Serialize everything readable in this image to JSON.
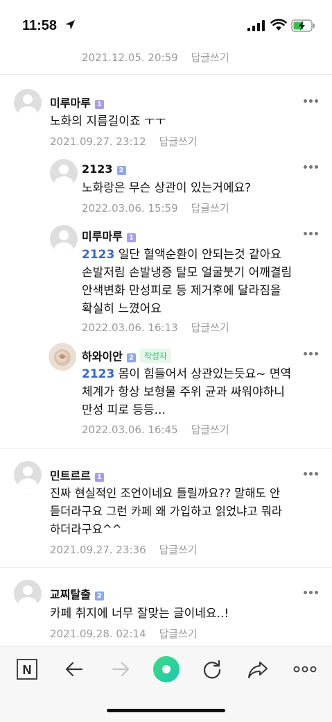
{
  "status_bar": {
    "time": "11:58"
  },
  "top_meta": {
    "date": "2021.12.05. 20:59",
    "reply": "답글쓰기"
  },
  "comments": [
    {
      "nick": "미루마루",
      "level": "1",
      "text": "노화의 지름길이죠 ㅜㅜ",
      "date": "2021.09.27. 23:12",
      "reply": "답글쓰기"
    },
    {
      "nick": "2123",
      "level": "2",
      "text": "노화랑은 무슨 상관이 있는거에요?",
      "date": "2022.03.06. 15:59",
      "reply": "답글쓰기"
    },
    {
      "nick": "미루마루",
      "level": "1",
      "mention": "2123",
      "text": "일단 혈액순환이 안되는것 같아요",
      "lines": [
        "손발저림 손발냉증 탈모 얼굴붓기 어깨결림",
        "안색변화 만성피로 등 제거후에 달라짐을",
        "확실히 느꼈어요"
      ],
      "date": "2022.03.06. 16:13",
      "reply": "답글쓰기"
    },
    {
      "nick": "하와이안",
      "level": "2",
      "badge": "작성자",
      "mention": "2123",
      "text": "몸이 힘들어서 상관있는듯요~ 면역",
      "lines": [
        "체계가 항상 보형물 주위 균과 싸워야하니",
        "만성 피로 등등..."
      ],
      "date": "2022.03.06. 16:45",
      "reply": "답글쓰기"
    },
    {
      "nick": "민트르르",
      "level": "1",
      "lines": [
        "진짜 현실적인 조언이네요 들릴까요?? 말해도 안",
        "듣더라구요 그런 카페 왜 가입하고 읽었냐고 뭐라",
        "하더라구요^^"
      ],
      "date": "2021.09.27. 23:36",
      "reply": "답글쓰기"
    },
    {
      "nick": "교찌탈출",
      "level": "2",
      "text": "카페 취지에 너무 잘맞는 글이네요..!",
      "date": "2021.09.28. 02:14",
      "reply": "답글쓰기"
    }
  ],
  "toolbar": {
    "n_label": "N"
  }
}
